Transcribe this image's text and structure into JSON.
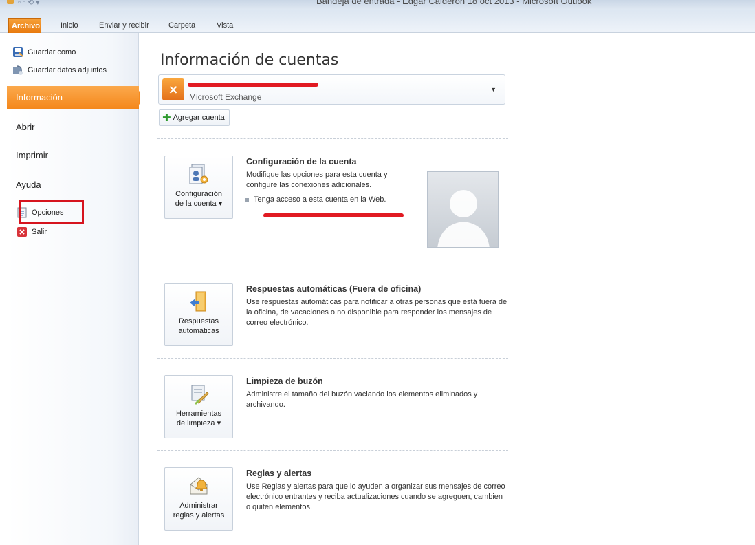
{
  "window": {
    "title": "Bandeja de entrada - Edgar Calderón 18 oct 2013 - Microsoft Outlook"
  },
  "ribbon": {
    "tabs": [
      "Archivo",
      "Inicio",
      "Enviar y recibir",
      "Carpeta",
      "Vista"
    ],
    "active_tab": "Archivo"
  },
  "backstage": {
    "commands_top": [
      {
        "label": "Guardar como",
        "icon": "save-as-icon"
      },
      {
        "label": "Guardar datos adjuntos",
        "icon": "save-attachments-icon"
      }
    ],
    "pages": [
      {
        "label": "Información",
        "selected": true
      },
      {
        "label": "Abrir",
        "selected": false
      },
      {
        "label": "Imprimir",
        "selected": false
      },
      {
        "label": "Ayuda",
        "selected": false
      }
    ],
    "commands_bottom": [
      {
        "label": "Opciones",
        "icon": "options-icon",
        "highlighted": true
      },
      {
        "label": "Salir",
        "icon": "exit-icon"
      }
    ],
    "highlight_color": "#d6141e",
    "selected_color": "#f68b1f"
  },
  "main": {
    "title": "Información de cuentas",
    "account": {
      "type": "Microsoft Exchange",
      "icon": "exchange-icon"
    },
    "add_account_label": "Agregar cuenta",
    "sections": [
      {
        "button_label_1": "Configuración",
        "button_label_2": "de la cuenta ▾",
        "heading": "Configuración de la cuenta",
        "description": "Modifique las opciones para esta cuenta y configure las conexiones adicionales.",
        "bullet": "Tenga acceso a esta cuenta en la Web.",
        "icon": "account-settings-icon"
      },
      {
        "button_label_1": "Respuestas",
        "button_label_2": "automáticas",
        "heading": "Respuestas automáticas (Fuera de oficina)",
        "description": "Use respuestas automáticas para notificar a otras personas que está fuera de la oficina, de vacaciones o no disponible para responder los mensajes de correo electrónico.",
        "icon": "automatic-replies-icon"
      },
      {
        "button_label_1": "Herramientas",
        "button_label_2": "de limpieza ▾",
        "heading": "Limpieza de buzón",
        "description": "Administre el tamaño del buzón vaciando los elementos eliminados y archivando.",
        "icon": "cleanup-tools-icon"
      },
      {
        "button_label_1": "Administrar",
        "button_label_2": "reglas y alertas",
        "heading": "Reglas y alertas",
        "description": "Use Reglas y alertas para que lo ayuden a organizar sus mensajes de correo electrónico entrantes y reciba actualizaciones cuando se agreguen, cambien o quiten elementos.",
        "icon": "rules-alerts-icon"
      }
    ]
  }
}
